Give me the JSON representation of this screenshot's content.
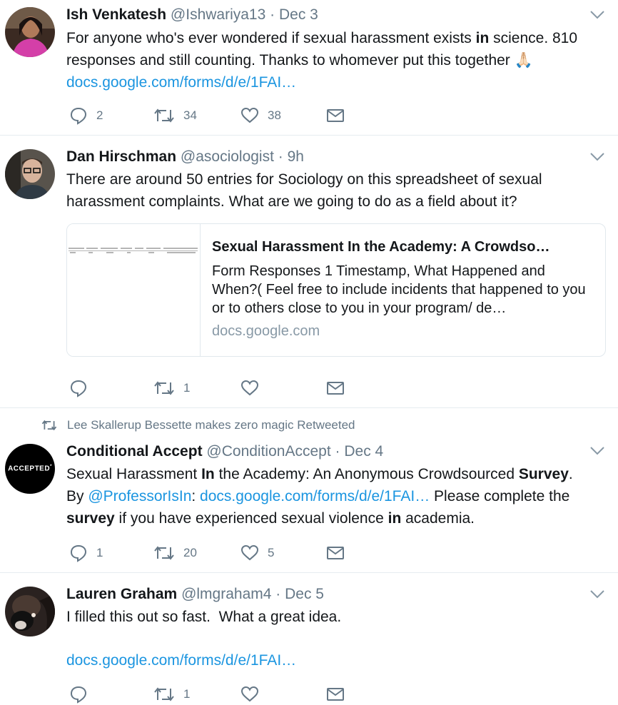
{
  "tweets": [
    {
      "name": "Ish Venkatesh",
      "handle": "@Ishwariya13",
      "sep": "·",
      "time": "Dec 3",
      "text": [
        {
          "t": "For anyone who's ever wondered if sexual harassment exists "
        },
        {
          "t": "in",
          "b": true
        },
        {
          "t": " science. 810 responses and still counting. Thanks to whomever put this together "
        }
      ],
      "emoji": "🙏🏻",
      "link": "docs.google.com/forms/d/e/1FAI…",
      "reply_count": "2",
      "retweet_count": "34",
      "like_count": "38"
    },
    {
      "name": "Dan Hirschman",
      "handle": "@asociologist",
      "sep": "·",
      "time": "9h",
      "text": [
        {
          "t": "There are around 50 entries for Sociology on this spreadsheet of sexual harassment complaints. What are we going to do as a field about it?"
        }
      ],
      "card": {
        "title": "Sexual Harassment In the Academy: A Crowdso…",
        "description": "Form Responses 1 Timestamp, What Happened and When?( Feel free to include incidents that happened to you or to others close to you in your program/ de…",
        "domain": "docs.google.com"
      },
      "reply_count": "",
      "retweet_count": "1",
      "like_count": ""
    },
    {
      "retweeted_by": "Lee Skallerup Bessette makes zero magic Retweeted",
      "name": "Conditional Accept",
      "handle": "@ConditionAccept",
      "sep": "·",
      "time": "Dec 4",
      "avatar_text": "ACCEPTED",
      "avatar_mark": "*",
      "text_line1": [
        {
          "t": "Sexual Harassment "
        },
        {
          "t": "In",
          "b": true
        },
        {
          "t": " the Academy: An Anonymous Crowdsourced "
        },
        {
          "t": "Survey",
          "b": true
        },
        {
          "t": "."
        }
      ],
      "text_line2": [
        {
          "t": "By "
        },
        {
          "t": "@ProfessorIsIn",
          "link": true
        },
        {
          "t": ": "
        },
        {
          "t": "docs.google.com/forms/d/e/1FAI…",
          "link": true
        },
        {
          "t": " Please complete the"
        }
      ],
      "text_line3": [
        {
          "t": "survey",
          "b": true
        },
        {
          "t": " if you have experienced sexual violence "
        },
        {
          "t": "in",
          "b": true
        },
        {
          "t": " academia."
        }
      ],
      "reply_count": "1",
      "retweet_count": "20",
      "like_count": "5"
    },
    {
      "name": "Lauren Graham",
      "handle": "@lmgraham4",
      "sep": "·",
      "time": "Dec 5",
      "text": [
        {
          "t": "I filled this out so fast.  What a great idea."
        }
      ],
      "link": "docs.google.com/forms/d/e/1FAI…",
      "reply_count": "",
      "retweet_count": "1",
      "like_count": ""
    }
  ],
  "colors": {
    "name": "#14171a",
    "meta": "#657786",
    "link": "#1b95e0",
    "divider": "#e6ecf0",
    "card_domain": "#8899a6"
  },
  "icons": [
    "reply-icon",
    "retweet-icon",
    "like-icon",
    "dm-icon",
    "chevron-down-icon"
  ]
}
